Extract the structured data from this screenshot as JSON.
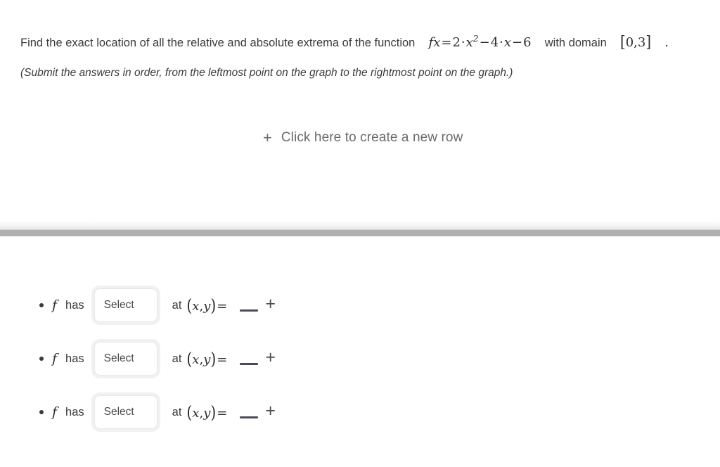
{
  "question": {
    "prompt_before_function": "Find the exact location of all the relative and absolute extrema of the function",
    "function_label": "f",
    "function_arg": "x",
    "function_equals": "=",
    "coef_a": "2",
    "dot": "·",
    "var_x": "x",
    "exponent": "2",
    "minus_1": "−",
    "coef_b": "4",
    "var_x2": "x",
    "minus_2": "−",
    "constant": "6",
    "prompt_after_function": "with domain",
    "domain_open": "[",
    "domain_start": "0,3",
    "domain_close": "]",
    "period": ".",
    "full_function_text": "f(x) = 2·x² − 4·x − 6",
    "domain_text": "[0,3]",
    "subprompt": "(Submit the answers in order, from the leftmost point on the graph to the rightmost point on the graph.)"
  },
  "new_row": {
    "icon": "plus-icon",
    "plus_glyph": "+",
    "label": "Click here to create a new row"
  },
  "answers": {
    "function_symbol": "f",
    "has_label": "has",
    "at_label": "at",
    "coord_open": "(",
    "coord_x": "x",
    "coord_comma": ",",
    "coord_y": "y",
    "coord_close": ")",
    "coord_equals": "=",
    "plus_glyph": "+",
    "rows": [
      {
        "select_value": "Select",
        "select_placeholder": "Select",
        "input_value": "",
        "input_placeholder": ""
      },
      {
        "select_value": "Select",
        "select_placeholder": "Select",
        "input_value": "",
        "input_placeholder": ""
      },
      {
        "select_value": "Select",
        "select_placeholder": "Select",
        "input_value": "",
        "input_placeholder": ""
      }
    ]
  },
  "colors": {
    "background": "#ffffff",
    "text": "#3b3b3b",
    "muted_text": "#6b6b6b",
    "math_text": "#2e2e2e",
    "divider_band": "#b0b0b0",
    "select_border": "#e7e7e7",
    "select_glow": "#f1f1f1",
    "input_rule": "#4c4c57"
  }
}
